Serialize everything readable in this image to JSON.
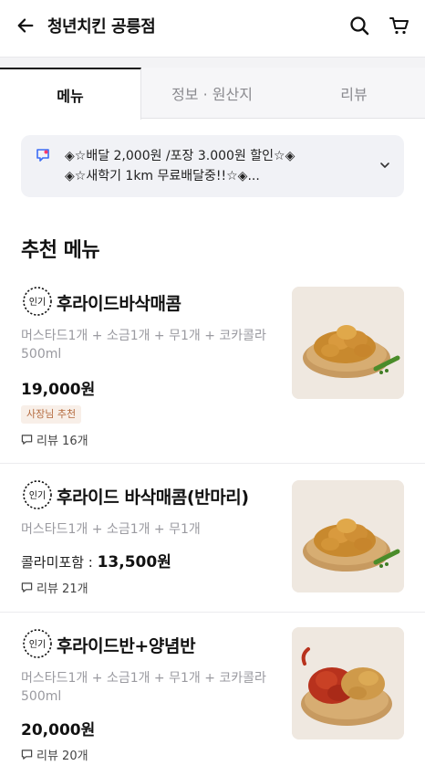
{
  "header": {
    "title": "청년치킨 공릉점",
    "icons": {
      "back": "arrow-left-icon",
      "search": "search-icon",
      "cart": "cart-icon"
    }
  },
  "tabs": [
    {
      "label": "메뉴",
      "active": true
    },
    {
      "label": "정보 · 원산지",
      "active": false
    },
    {
      "label": "리뷰",
      "active": false
    }
  ],
  "notice": {
    "line1": "◈☆배달 2,000원 /포장 3.000원 할인☆◈",
    "line2": "◈☆새학기 1km 무료배달중!!☆◈...",
    "icon": "megaphone-icon"
  },
  "section": {
    "title": "추천 메뉴"
  },
  "popular_badge": "인기",
  "menu": [
    {
      "name": "후라이드바삭매콤",
      "desc": "머스타드1개 + 소금1개 + 무1개 + 코카콜라 500ml",
      "price": "19,000원",
      "price_prefix": "",
      "tag": "사장님 추천",
      "reviews": "리뷰 16개"
    },
    {
      "name": "후라이드 바삭매콤(반마리)",
      "desc": "머스타드1개 + 소금1개 + 무1개",
      "price": "13,500원",
      "price_prefix": "콜라미포함 : ",
      "tag": "",
      "reviews": "리뷰 21개"
    },
    {
      "name": "후라이드반+양념반",
      "desc": "머스타드1개 + 소금1개 + 무1개 + 코카콜라 500ml",
      "price": "20,000원",
      "price_prefix": "",
      "tag": "",
      "reviews": "리뷰 20개"
    }
  ],
  "colors": {
    "accent_notice": "#3b6cf5",
    "owner_tag_bg": "#f8efe8",
    "owner_tag_text": "#b46a3e"
  }
}
